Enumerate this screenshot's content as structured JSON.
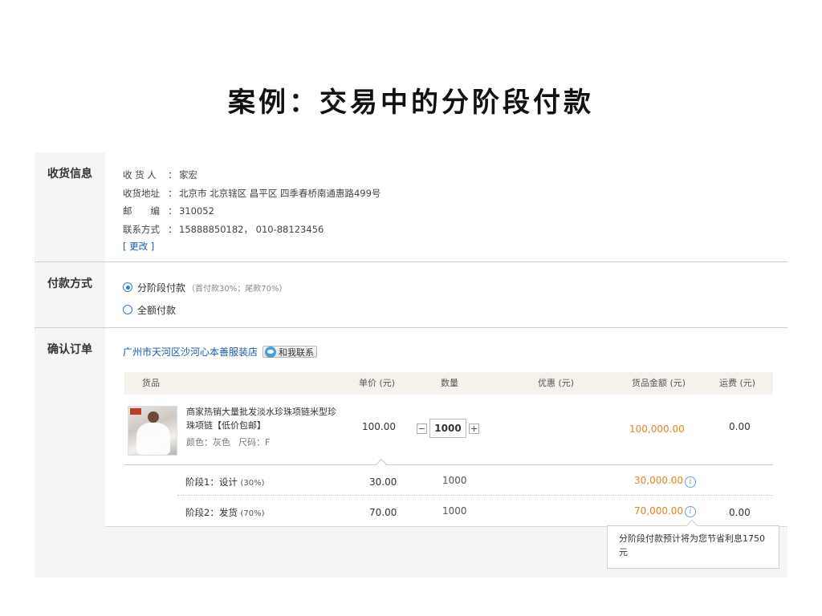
{
  "title": "案例：交易中的分阶段付款",
  "address_section": {
    "label": "收货信息",
    "rows": [
      {
        "key": "收 货 人",
        "value": "家宏"
      },
      {
        "key": "收货地址",
        "value": "北京市 北京辖区 昌平区 四季春桥南通惠路499号"
      },
      {
        "key": "邮　　编",
        "value": "310052"
      },
      {
        "key": "联系方式",
        "value": "15888850182， 010-88123456"
      }
    ],
    "separator": "：",
    "change_link": "[ 更改 ]"
  },
  "payment_section": {
    "label": "付款方式",
    "options": [
      {
        "label": "分阶段付款",
        "hint": "（首付款30%；尾款70%）",
        "selected": true
      },
      {
        "label": "全额付款",
        "hint": "",
        "selected": false
      }
    ]
  },
  "order_section": {
    "label": "确认订单",
    "shop_name": "广州市天河区沙河心本善服装店",
    "contact_label": "和我联系",
    "columns": {
      "goods": "货品",
      "unit_price": "单价 (元)",
      "quantity": "数量",
      "discount": "优惠 (元)",
      "amount": "货品金额 (元)",
      "shipping": "运费 (元)"
    },
    "item": {
      "name": "商家热销大量批发淡水珍珠项链米型珍珠项链【低价包邮】",
      "spec_color": "颜色：灰色",
      "spec_size": "尺码：F",
      "unit_price": "100.00",
      "quantity": "1000",
      "qty_minus": "−",
      "qty_plus": "+",
      "amount": "100,000.00",
      "shipping": "0.00"
    },
    "stages": [
      {
        "label": "阶段1：设计",
        "pct": "(30%)",
        "price": "30.00",
        "quantity": "1000",
        "amount": "30,000.00",
        "shipping": ""
      },
      {
        "label": "阶段2：发货",
        "pct": "(70%)",
        "price": "70.00",
        "quantity": "1000",
        "amount": "70,000.00",
        "shipping": "0.00"
      }
    ],
    "info_glyph": "i"
  },
  "tooltip": {
    "text": "分阶段付款预计将为您节省利息1750元"
  },
  "colors": {
    "accent_orange": "#e8821a",
    "link_blue": "#1a5aa8",
    "panel_bg": "#f5f5f5"
  }
}
